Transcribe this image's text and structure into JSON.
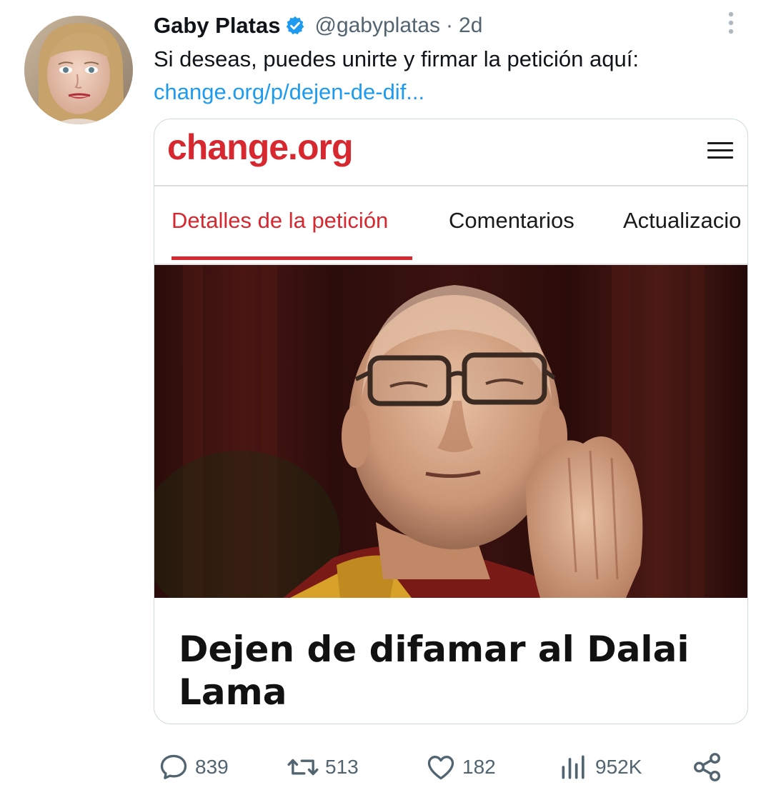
{
  "tweet": {
    "author_name": "Gaby Platas",
    "handle": "@gabyplatas",
    "separator": "·",
    "time": "2d",
    "text": "Si deseas, puedes unirte y firmar la petición aquí:",
    "link": "change.org/p/dejen-de-dif..."
  },
  "card": {
    "logo": "change.org",
    "tabs": [
      "Detalles de la petición",
      "Comentarios",
      "Actualizacio"
    ],
    "active_tab": 0,
    "title": "Dejen de difamar al Dalai Lama"
  },
  "actions": {
    "replies": "839",
    "retweets": "513",
    "likes": "182",
    "views": "952K"
  },
  "colors": {
    "link_blue": "#1d9bf0",
    "change_red": "#d7282f",
    "muted": "#536471"
  },
  "icons": [
    "verified-badge-icon",
    "more-options-icon",
    "menu-icon",
    "reply-icon",
    "retweet-icon",
    "like-icon",
    "views-icon",
    "share-icon"
  ]
}
